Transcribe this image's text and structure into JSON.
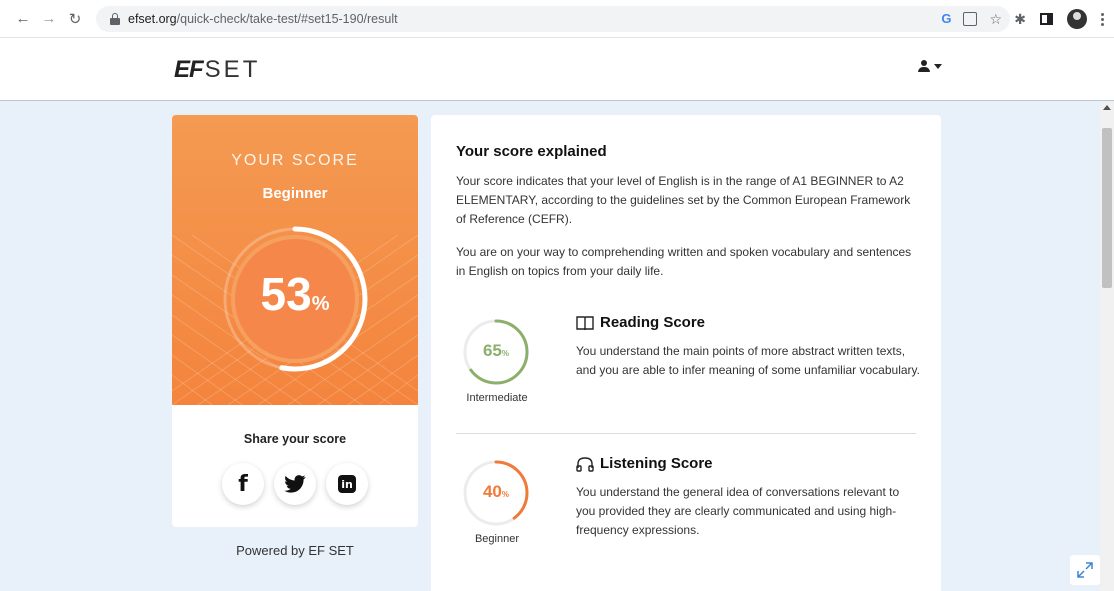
{
  "browser": {
    "url_host": "efset.org",
    "url_path": "/quick-check/take-test/#set15-190/result"
  },
  "site": {
    "logo_ef": "EF",
    "logo_set": "SET"
  },
  "score_card": {
    "heading": "YOUR SCORE",
    "level": "Beginner",
    "percent": "53",
    "percent_fraction": 0.53,
    "percent_unit": "%",
    "share_title": "Share your score",
    "share_buttons": [
      "facebook-icon",
      "twitter-icon",
      "linkedin-icon"
    ],
    "linkedin_glyph": "in",
    "facebook_glyph": "f",
    "accent_color": "#f4843d"
  },
  "powered_by": "Powered by EF SET",
  "explanation": {
    "title": "Your score explained",
    "paragraph1": "Your score indicates that your level of English is in the range of A1 BEGINNER to A2 ELEMENTARY, according to the guidelines set by the Common European Framework of Reference (CEFR).",
    "paragraph2": "You are on your way to comprehending written and spoken vocabulary and sentences in English on topics from your daily life.",
    "reading": {
      "title": "Reading Score",
      "percent": "65",
      "percent_fraction": 0.65,
      "unit": "%",
      "level": "Intermediate",
      "text": "You understand the main points of more abstract written texts, and you are able to infer meaning of some unfamiliar vocabulary.",
      "color": "#8bb06a"
    },
    "listening": {
      "title": "Listening Score",
      "percent": "40",
      "percent_fraction": 0.4,
      "unit": "%",
      "level": "Beginner",
      "text": "You understand the general idea of conversations relevant to you provided they are clearly communicated and using high-frequency expressions.",
      "color": "#f07a3a"
    }
  }
}
